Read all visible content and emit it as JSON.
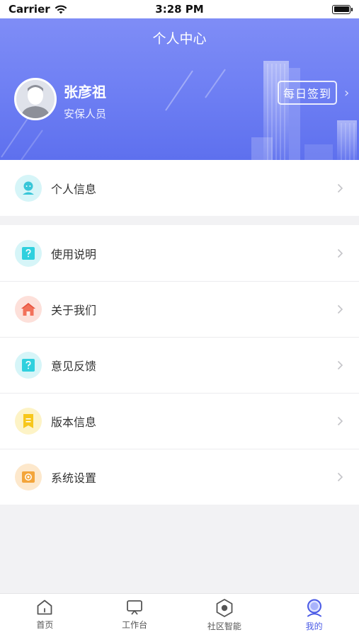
{
  "status_bar": {
    "carrier": "Carrier",
    "time": "3:28 PM"
  },
  "header": {
    "title": "个人中心",
    "user_name": "张彦祖",
    "user_role": "安保人员",
    "checkin_label": "每日签到"
  },
  "menu_group_1": [
    {
      "label": "个人信息",
      "icon": "person-icon",
      "color": "#38c6d8"
    }
  ],
  "menu_group_2": [
    {
      "label": "使用说明",
      "icon": "question-icon",
      "color": "#2fd0de"
    },
    {
      "label": "关于我们",
      "icon": "home-icon",
      "color": "#f2715a"
    },
    {
      "label": "意见反馈",
      "icon": "feedback-icon",
      "color": "#2fd0de"
    },
    {
      "label": "版本信息",
      "icon": "bookmark-icon",
      "color": "#f7c71c"
    },
    {
      "label": "系统设置",
      "icon": "settings-icon",
      "color": "#f3a53b"
    }
  ],
  "tab_bar": [
    {
      "label": "首页",
      "icon": "home-outline-icon",
      "active": false
    },
    {
      "label": "工作台",
      "icon": "workbench-icon",
      "active": false
    },
    {
      "label": "社区智能",
      "icon": "community-hex-icon",
      "active": false
    },
    {
      "label": "我的",
      "icon": "profile-icon",
      "active": true
    }
  ],
  "colors": {
    "accent": "#4b5be6",
    "header_top": "#7f8df6",
    "header_bottom": "#5e70ee"
  }
}
